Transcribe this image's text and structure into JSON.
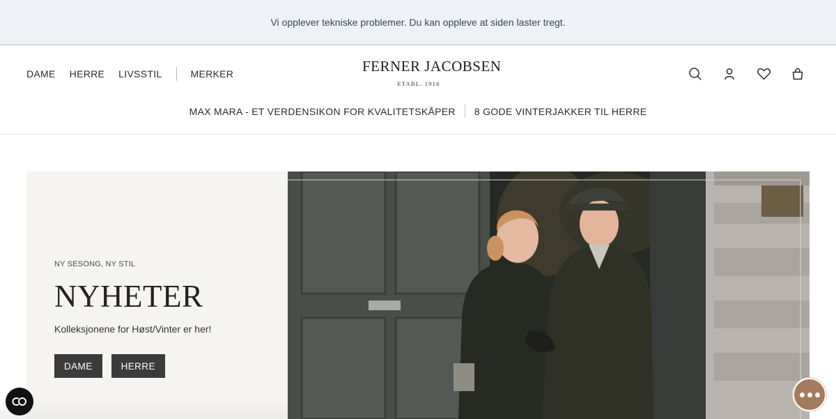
{
  "notice": {
    "text": "Vi opplever tekniske problemer. Du kan oppleve at siden laster tregt."
  },
  "nav": {
    "items": [
      {
        "label": "DAME"
      },
      {
        "label": "HERRE"
      },
      {
        "label": "LIVSSTIL"
      }
    ],
    "brands_label": "MERKER"
  },
  "logo": {
    "name": "FERNER JACOBSEN",
    "sub": "ETABL. 1916"
  },
  "header_icons": [
    "search-icon",
    "user-icon",
    "heart-icon",
    "bag-icon"
  ],
  "subnav": {
    "items": [
      {
        "label": "MAX MARA - ET VERDENSIKON FOR KVALITETSKÅPER"
      },
      {
        "label": "8 GODE VINTERJAKKER TIL HERRE"
      }
    ]
  },
  "hero": {
    "eyebrow": "NY SESONG, NY STIL",
    "title": "NYHETER",
    "description": "Kolleksjonene for Høst/Vinter er her!",
    "buttons": [
      {
        "label": "DAME"
      },
      {
        "label": "HERRE"
      }
    ]
  },
  "colors": {
    "notice_bg": "#eef2f7",
    "hero_panel_bg": "#f6f4f0",
    "button_bg": "#3b3b3b",
    "chat_accent": "#a57a5c"
  }
}
